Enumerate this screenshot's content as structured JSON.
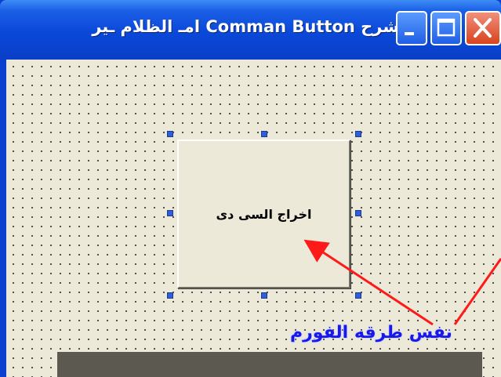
{
  "window": {
    "title": "شرح Comman Button امـ الظلام ـير",
    "title_bar_color": "#0a48d8",
    "close_button_color": "#d8431f"
  },
  "command_button": {
    "label": "اخراج السى دى"
  },
  "annotation": {
    "caption": "نفس طرقه الفورم",
    "arrow_color": "#ff1a1a",
    "caption_color": "#1a18e8"
  },
  "icons": {
    "app": "vb-form-icon",
    "minimize": "minimize-icon",
    "maximize": "maximize-icon",
    "close": "close-icon"
  }
}
